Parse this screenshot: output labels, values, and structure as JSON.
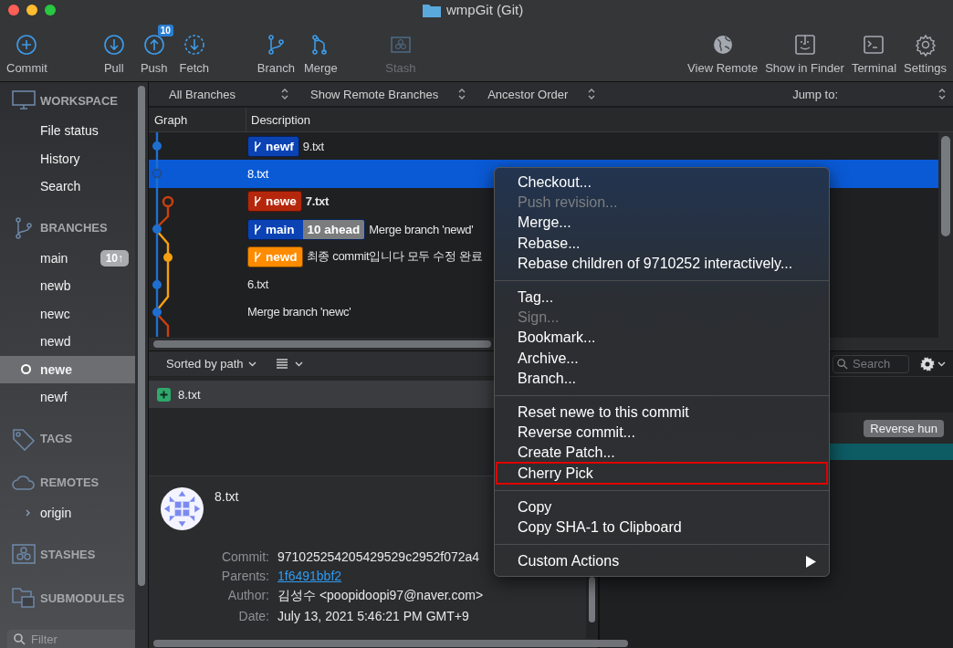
{
  "window": {
    "title": "wmpGit (Git)"
  },
  "toolbar": {
    "left": [
      [
        {
          "label": "Commit",
          "disabled": false
        }
      ],
      [
        {
          "label": "Pull",
          "disabled": false
        },
        {
          "label": "Push",
          "disabled": false,
          "badge": "10"
        },
        {
          "label": "Fetch",
          "disabled": false
        }
      ],
      [
        {
          "label": "Branch",
          "disabled": false
        },
        {
          "label": "Merge",
          "disabled": false
        }
      ],
      [
        {
          "label": "Stash",
          "disabled": true
        }
      ]
    ],
    "right": [
      {
        "label": "View Remote",
        "disabled": false
      },
      {
        "label": "Show in Finder",
        "disabled": false
      },
      {
        "label": "Terminal",
        "disabled": false
      },
      {
        "label": "Settings",
        "disabled": false
      }
    ]
  },
  "sidebar": {
    "sections": [
      {
        "title": "WORKSPACE",
        "items": [
          {
            "label": "File status",
            "selected": false
          },
          {
            "label": "History",
            "selected": false
          },
          {
            "label": "Search",
            "selected": false
          }
        ]
      },
      {
        "title": "BRANCHES",
        "items": [
          {
            "label": "main",
            "selected": false,
            "current": false,
            "badge": "10↑"
          },
          {
            "label": "newb",
            "selected": false,
            "current": false
          },
          {
            "label": "newc",
            "selected": false,
            "current": false
          },
          {
            "label": "newd",
            "selected": false,
            "current": false
          },
          {
            "label": "newe",
            "selected": true,
            "current": true
          },
          {
            "label": "newf",
            "selected": false,
            "current": false
          }
        ]
      },
      {
        "title": "TAGS"
      },
      {
        "title": "REMOTES",
        "items": [
          {
            "label": "origin",
            "selected": false,
            "expanded": false
          }
        ]
      },
      {
        "title": "STASHES"
      },
      {
        "title": "SUBMODULES"
      }
    ],
    "filter": {
      "placeholder": "Filter"
    }
  },
  "filter_bar": {
    "dropdowns": [
      "All Branches",
      "Show Remote Branches",
      "Ancestor Order"
    ],
    "jump_to": "Jump to:"
  },
  "table": {
    "columns": [
      "Graph",
      "Description"
    ],
    "rows": [
      {
        "selected": false,
        "head": false,
        "refs": [
          {
            "name": "newf",
            "color": "#0b43b5"
          }
        ],
        "message": "9.txt"
      },
      {
        "selected": true,
        "head": false,
        "refs": [],
        "message": "8.txt"
      },
      {
        "selected": false,
        "head": true,
        "refs": [
          {
            "name": "newe",
            "color": "#b5270c"
          }
        ],
        "message": "7.txt"
      },
      {
        "selected": false,
        "head": false,
        "refs": [
          {
            "name": "main",
            "color": "#0b43b5",
            "ahead": "10 ahead"
          }
        ],
        "message": "Merge branch 'newd'"
      },
      {
        "selected": false,
        "head": false,
        "refs": [
          {
            "name": "newd",
            "color": "#ff8c00"
          }
        ],
        "message": "최종 commit입니다 모두 수정 완료"
      },
      {
        "selected": false,
        "head": false,
        "refs": [],
        "message": "6.txt"
      },
      {
        "selected": false,
        "head": false,
        "refs": [],
        "message": "Merge branch 'newc'"
      }
    ]
  },
  "files": {
    "sort": "Sorted by path",
    "items": [
      {
        "name": "8.txt",
        "kind": "added"
      }
    ]
  },
  "details": {
    "subject": "8.txt",
    "fields": [
      {
        "label": "Commit:",
        "value": "971025254205429529c2952f072a4",
        "link": false
      },
      {
        "label": "Parents:",
        "value": "1f6491bbf2",
        "link": true
      },
      {
        "label": "Author:",
        "value": "김성수 <poopidoopi97@naver.com>",
        "link": false
      },
      {
        "label": "Date:",
        "value": "July 13, 2021 5:46:21 PM GMT+9",
        "link": false
      }
    ]
  },
  "diff": {
    "search_placeholder": "Search",
    "button": "Reverse hun"
  },
  "context_menu": {
    "groups": [
      [
        {
          "label": "Checkout...",
          "disabled": false,
          "highlighted": false
        },
        {
          "label": "Push revision...",
          "disabled": true,
          "highlighted": false
        },
        {
          "label": "Merge...",
          "disabled": false,
          "highlighted": false
        },
        {
          "label": "Rebase...",
          "disabled": false,
          "highlighted": false
        },
        {
          "label": "Rebase children of 9710252 interactively...",
          "disabled": false,
          "highlighted": false
        }
      ],
      [
        {
          "label": "Tag...",
          "disabled": false,
          "highlighted": false
        },
        {
          "label": "Sign...",
          "disabled": true,
          "highlighted": false
        },
        {
          "label": "Bookmark...",
          "disabled": false,
          "highlighted": false
        },
        {
          "label": "Archive...",
          "disabled": false,
          "highlighted": false
        },
        {
          "label": "Branch...",
          "disabled": false,
          "highlighted": false
        }
      ],
      [
        {
          "label": "Reset newe to this commit",
          "disabled": false,
          "highlighted": false
        },
        {
          "label": "Reverse commit...",
          "disabled": false,
          "highlighted": false
        },
        {
          "label": "Create Patch...",
          "disabled": false,
          "highlighted": false
        },
        {
          "label": "Cherry Pick",
          "disabled": false,
          "highlighted": true
        }
      ],
      [
        {
          "label": "Copy",
          "disabled": false,
          "highlighted": false
        },
        {
          "label": "Copy SHA-1 to Clipboard",
          "disabled": false,
          "highlighted": false
        }
      ],
      [
        {
          "label": "Custom Actions",
          "disabled": false,
          "highlighted": false,
          "submenu": true
        }
      ]
    ]
  }
}
